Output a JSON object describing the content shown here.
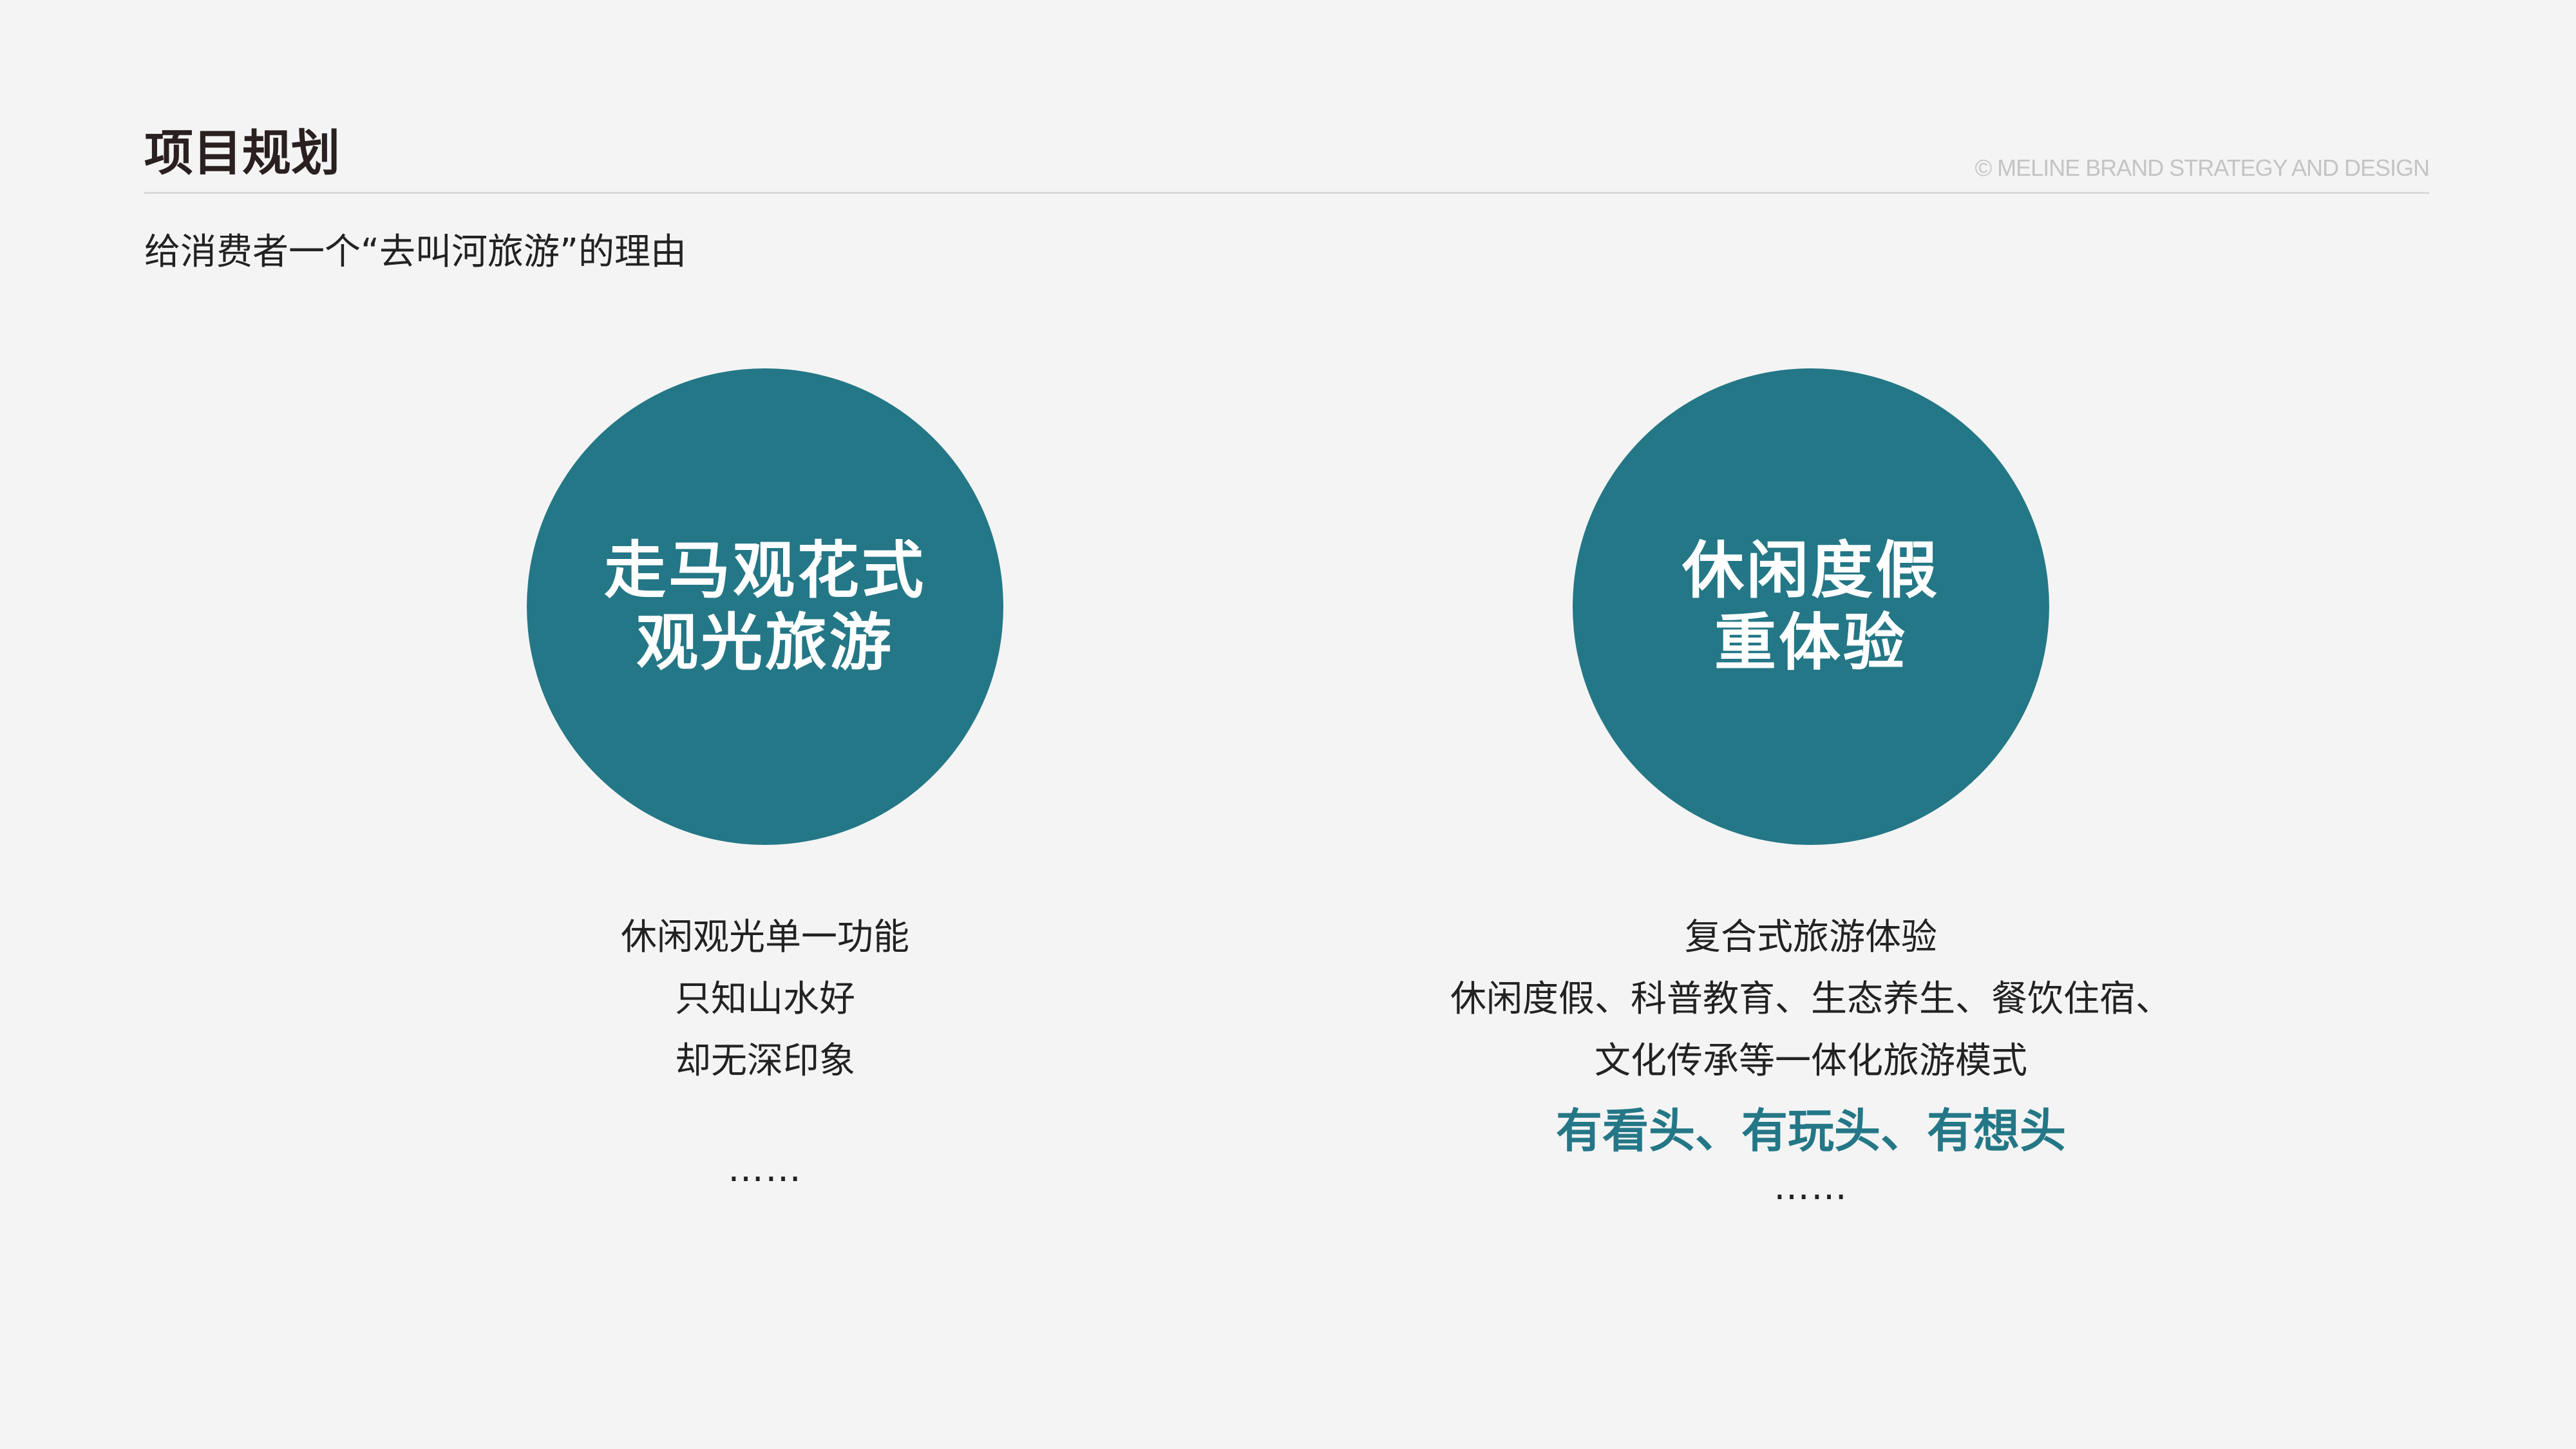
{
  "header": {
    "title": "项目规划",
    "copyright": "© MELINE BRAND STRATEGY AND DESIGN"
  },
  "subtitle": "给消费者一个“去叫河旅游”的理由",
  "left": {
    "circle_lines": [
      "走马观花式",
      "观光旅游"
    ],
    "description_lines": [
      "休闲观光单一功能",
      "只知山水好",
      "却无深印象"
    ],
    "ellipsis": "……"
  },
  "right": {
    "circle_lines": [
      "休闲度假",
      "重体验"
    ],
    "description_lines": [
      "复合式旅游体验",
      "休闲度假、科普教育、生态养生、餐饮住宿、",
      "文化传承等一体化旅游模式"
    ],
    "highlight": "有看头、有玩头、有想头",
    "ellipsis": "……"
  },
  "colors": {
    "accent": "#247786",
    "background": "#f4f4f4",
    "title": "#2a2020",
    "copyright": "#c4c4c4"
  }
}
